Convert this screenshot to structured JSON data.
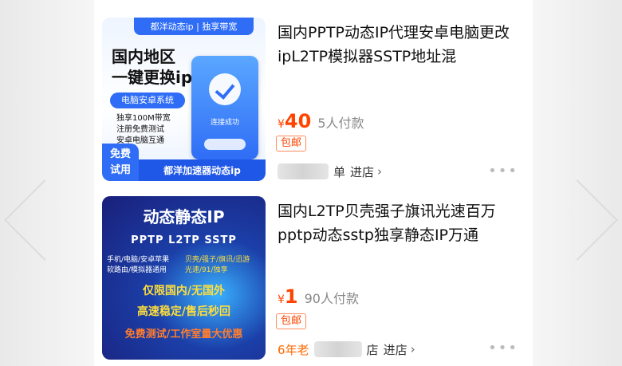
{
  "items": [
    {
      "thumb": {
        "tab": "都洋动态ip | 独享带宽",
        "headline_l1": "国内地区",
        "headline_l2": "一键更换ip",
        "pill": "电脑安卓系统",
        "notes": [
          "独享100M带宽",
          "注册免费测试",
          "安卓电脑互通"
        ],
        "phone_text": "连接成功",
        "free_badge": "免费\n试用",
        "brand": "都洋加速器动态ip"
      },
      "title": "国内PPTP动态IP代理安卓电脑更改ipL2TP模拟器SSTP地址混",
      "currency": "¥",
      "price": "40",
      "sold": "5人付款",
      "tag": "包邮",
      "shop_prefix": "",
      "shop_suffix": "单",
      "enter": "进店",
      "more": "•••"
    },
    {
      "thumb": {
        "title": "动态静态IP",
        "protocols": "PPTP   L2TP   SSTP",
        "left_lines": [
          "手机/电脑/安卓苹果",
          "软路由/模拟器通用"
        ],
        "right_lines": [
          "贝壳/强子/旗讯/迅游",
          "光速/91/独享"
        ],
        "line1": "仅限国内/无国外",
        "line2": "高速稳定/售后秒回",
        "line3": "免费测试/工作室量大优惠"
      },
      "title": "国内L2TP贝壳强子旗讯光速百万pptp动态sstp独享静态IP万通",
      "currency": "¥",
      "price": "1",
      "sold": "90人付款",
      "tag": "包邮",
      "shop_prefix": "6年老",
      "shop_suffix": "店",
      "enter": "进店",
      "more": "•••"
    }
  ],
  "colors": {
    "price": "#ff4400",
    "accent": "#2f6df6"
  }
}
